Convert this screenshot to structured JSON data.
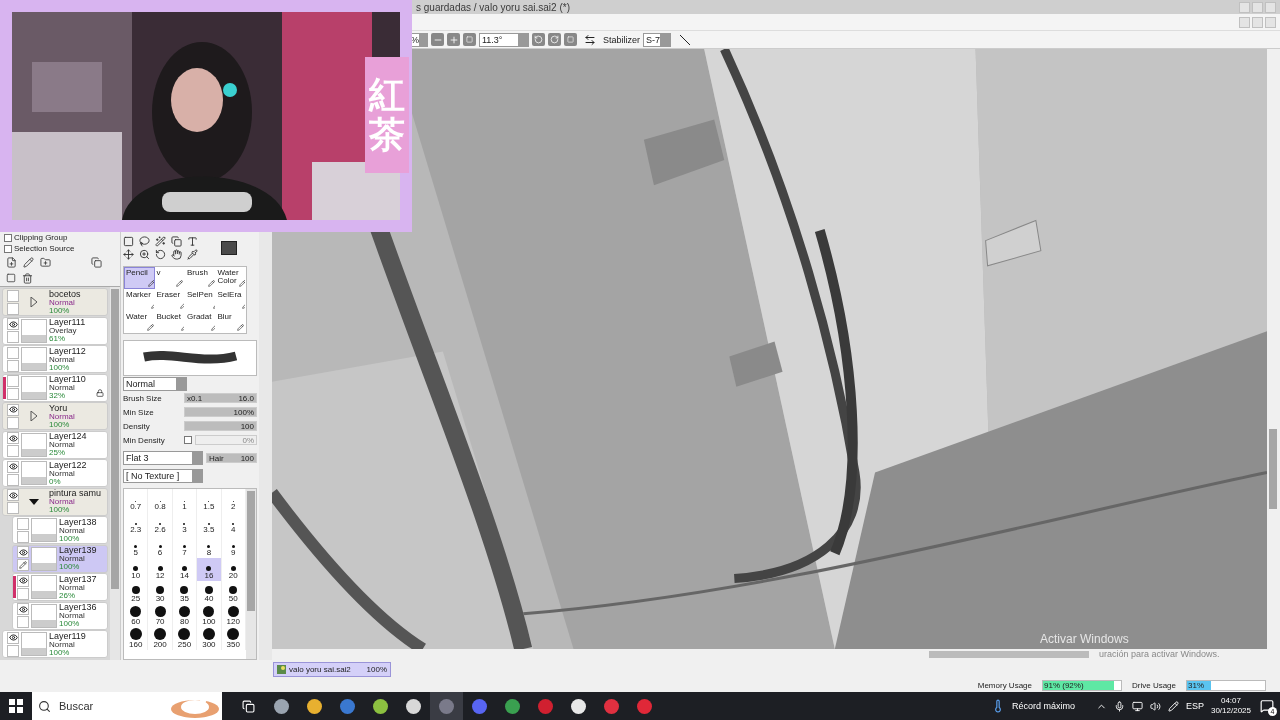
{
  "window": {
    "title": "s guardadas / valo yoru sai.sai2 (*)"
  },
  "overlay": {
    "sign": "紅茶"
  },
  "toolbar": {
    "zoom": "%",
    "angle": "11.3°",
    "stabilizer_label": "Stabilizer",
    "stabilizer": "S-7"
  },
  "layer_panel": {
    "options": [
      {
        "label": "Clipping Group",
        "checked": false
      },
      {
        "label": "Selection Source",
        "checked": false
      }
    ],
    "layers": [
      {
        "kind": "folder",
        "name": "bocetos",
        "mode": "Normal",
        "opacity": "100%",
        "visible": false,
        "editing": false,
        "selected": false,
        "expanded": false,
        "clipped": false,
        "locked": false
      },
      {
        "kind": "layer",
        "name": "Layer111",
        "mode": "Overlay",
        "opacity": "61%",
        "visible": true,
        "editing": false,
        "selected": false,
        "clipped": false,
        "locked": false
      },
      {
        "kind": "layer",
        "name": "Layer112",
        "mode": "Normal",
        "opacity": "100%",
        "visible": false,
        "editing": false,
        "selected": false,
        "clipped": false,
        "locked": false
      },
      {
        "kind": "layer",
        "name": "Layer110",
        "mode": "Normal",
        "opacity": "32%",
        "visible": false,
        "editing": false,
        "selected": false,
        "clipped": true,
        "locked": true
      },
      {
        "kind": "folder",
        "name": "Yoru",
        "mode": "Normal",
        "opacity": "100%",
        "visible": true,
        "editing": false,
        "selected": false,
        "expanded": false,
        "clipped": false,
        "locked": false
      },
      {
        "kind": "layer",
        "name": "Layer124",
        "mode": "Normal",
        "opacity": "25%",
        "visible": true,
        "editing": false,
        "selected": false,
        "clipped": false,
        "locked": false
      },
      {
        "kind": "layer",
        "name": "Layer122",
        "mode": "Normal",
        "opacity": "0%",
        "visible": true,
        "editing": false,
        "selected": false,
        "clipped": false,
        "locked": false
      },
      {
        "kind": "folder",
        "name": "pintura samu",
        "mode": "Normal",
        "opacity": "100%",
        "visible": true,
        "editing": false,
        "selected": false,
        "expanded": true,
        "clipped": false,
        "locked": false,
        "children": [
          {
            "kind": "layer",
            "name": "Layer138",
            "mode": "Normal",
            "opacity": "100%",
            "visible": false,
            "editing": false,
            "selected": false,
            "clipped": false,
            "locked": false
          },
          {
            "kind": "layer",
            "name": "Layer139",
            "mode": "Normal",
            "opacity": "100%",
            "visible": true,
            "editing": true,
            "selected": true,
            "clipped": false,
            "locked": false
          },
          {
            "kind": "layer",
            "name": "Layer137",
            "mode": "Normal",
            "opacity": "26%",
            "visible": true,
            "editing": false,
            "selected": false,
            "clipped": true,
            "locked": false
          },
          {
            "kind": "layer",
            "name": "Layer136",
            "mode": "Normal",
            "opacity": "100%",
            "visible": true,
            "editing": false,
            "selected": false,
            "clipped": false,
            "locked": false
          }
        ]
      },
      {
        "kind": "layer",
        "name": "Layer119",
        "mode": "Normal",
        "opacity": "100%",
        "visible": true,
        "editing": false,
        "selected": false,
        "clipped": false,
        "locked": false
      }
    ]
  },
  "tools": [
    {
      "label": "Pencil",
      "selected": true
    },
    {
      "label": "v",
      "selected": false
    },
    {
      "label": "Brush",
      "selected": false
    },
    {
      "label": "Water Color",
      "selected": false
    },
    {
      "label": "Marker",
      "selected": false
    },
    {
      "label": "Eraser",
      "selected": false
    },
    {
      "label": "SelPen",
      "selected": false
    },
    {
      "label": "SelEra",
      "selected": false
    },
    {
      "label": "Water",
      "selected": false
    },
    {
      "label": "Bucket",
      "selected": false
    },
    {
      "label": "Gradat",
      "selected": false
    },
    {
      "label": "Blur",
      "selected": false
    }
  ],
  "brush": {
    "mode": "Normal",
    "sliders": [
      {
        "kind": "size",
        "label": "Brush Size",
        "prefix": "x0.1",
        "value": "16.0",
        "level": 1
      },
      {
        "kind": "minsize",
        "label": "Min Size",
        "value": "100%",
        "level": 1
      },
      {
        "kind": "plain",
        "label": "Density",
        "value": "100",
        "level": 1
      },
      {
        "kind": "check",
        "label": "Min Density",
        "value": "0%",
        "checked": false
      }
    ],
    "shape": "Flat 3",
    "hair": {
      "label": "Hair",
      "value": "100",
      "level": 1
    },
    "texture": "[ No Texture ]"
  },
  "sizes": [
    {
      "label": "0.7",
      "selected": false
    },
    {
      "label": "0.8",
      "selected": false
    },
    {
      "label": "1",
      "selected": false
    },
    {
      "label": "1.5",
      "selected": false
    },
    {
      "label": "2",
      "selected": false
    },
    {
      "label": "2.3",
      "selected": false
    },
    {
      "label": "2.6",
      "selected": false
    },
    {
      "label": "3",
      "selected": false
    },
    {
      "label": "3.5",
      "selected": false
    },
    {
      "label": "4",
      "selected": false
    },
    {
      "label": "5",
      "selected": false
    },
    {
      "label": "6",
      "selected": false
    },
    {
      "label": "7",
      "selected": false
    },
    {
      "label": "8",
      "selected": false
    },
    {
      "label": "9",
      "selected": false
    },
    {
      "label": "10",
      "selected": false
    },
    {
      "label": "12",
      "selected": false
    },
    {
      "label": "14",
      "selected": false
    },
    {
      "label": "16",
      "selected": true
    },
    {
      "label": "20",
      "selected": false
    },
    {
      "label": "25",
      "selected": false
    },
    {
      "label": "30",
      "selected": false
    },
    {
      "label": "35",
      "selected": false
    },
    {
      "label": "40",
      "selected": false
    },
    {
      "label": "50",
      "selected": false
    },
    {
      "label": "60",
      "selected": false
    },
    {
      "label": "70",
      "selected": false
    },
    {
      "label": "80",
      "selected": false
    },
    {
      "label": "100",
      "selected": false
    },
    {
      "label": "120",
      "selected": false
    },
    {
      "label": "160",
      "selected": false
    },
    {
      "label": "200",
      "selected": false
    },
    {
      "label": "250",
      "selected": false
    },
    {
      "label": "300",
      "selected": false
    },
    {
      "label": "350",
      "selected": false
    }
  ],
  "activation": {
    "title": "Activar Windows",
    "subtitle": "uración para activar Windows."
  },
  "documents": [
    {
      "name": "valo yoru sai.sai2",
      "zoom": "100%",
      "selected": true
    }
  ],
  "status_bar": [
    {
      "label": "Memory Usage",
      "value": "91% (92%)",
      "level": 0.91,
      "color": "#5ee8a4"
    },
    {
      "label": "Drive Usage",
      "value": "31%",
      "level": 0.31,
      "color": "#5ac4f0"
    }
  ],
  "taskbar": {
    "search_placeholder": "Buscar",
    "apps": [
      {
        "color": "#9aa4b0",
        "selected": false
      },
      {
        "color": "#e8b030",
        "selected": false
      },
      {
        "color": "#3a78d0",
        "selected": false
      },
      {
        "color": "#8cc040",
        "selected": false
      },
      {
        "color": "#d8d8d8",
        "selected": false
      },
      {
        "color": "#7a7a8a",
        "selected": true
      },
      {
        "color": "#5865f2",
        "selected": false
      },
      {
        "color": "#3aa050",
        "selected": false
      },
      {
        "color": "#d02030",
        "selected": false
      },
      {
        "color": "#e8e8e8",
        "selected": false
      },
      {
        "color": "#e03040",
        "selected": false
      },
      {
        "color": "#e02838",
        "selected": false
      }
    ],
    "weather": "Récord máximo",
    "language": "ESP",
    "time": "04:07",
    "date": "30/12/2025",
    "notifications": "4"
  }
}
